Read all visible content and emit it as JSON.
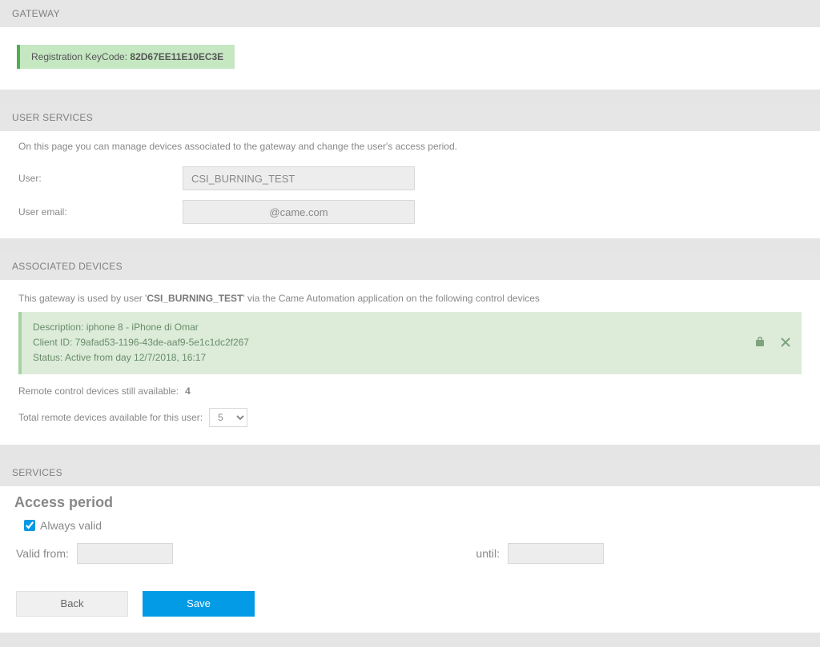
{
  "gateway": {
    "header": "GATEWAY",
    "keycode_label": "Registration KeyCode: ",
    "keycode_value": "82D67EE11E10EC3E"
  },
  "user_services": {
    "header": "USER SERVICES",
    "desc": "On this page you can manage devices associated to the gateway and change the user's access period.",
    "user_label": "User:",
    "user_value": "CSI_BURNING_TEST",
    "email_label": "User email:",
    "email_value": "@came.com"
  },
  "associated_devices": {
    "header": "ASSOCIATED DEVICES",
    "intro_prefix": "This gateway is used by user '",
    "intro_user": "CSI_BURNING_TEST",
    "intro_suffix": "' via the Came Automation application on the following control devices",
    "device": {
      "description": "Description: iphone 8 - iPhone di Omar",
      "client_id": "Client ID: 79afad53-1196-43de-aaf9-5e1c1dc2f267",
      "status": "Status: Active from day 12/7/2018, 16:17"
    },
    "remaining_label": "Remote control devices still available: ",
    "remaining_value": "4",
    "total_label": "Total remote devices available for this user:",
    "total_value": "5"
  },
  "services": {
    "header": "SERVICES",
    "access_title": "Access period",
    "always_valid_label": "Always valid",
    "always_valid_checked": true,
    "valid_from_label": "Valid from:",
    "until_label": "until:",
    "back_label": "Back",
    "save_label": "Save"
  }
}
